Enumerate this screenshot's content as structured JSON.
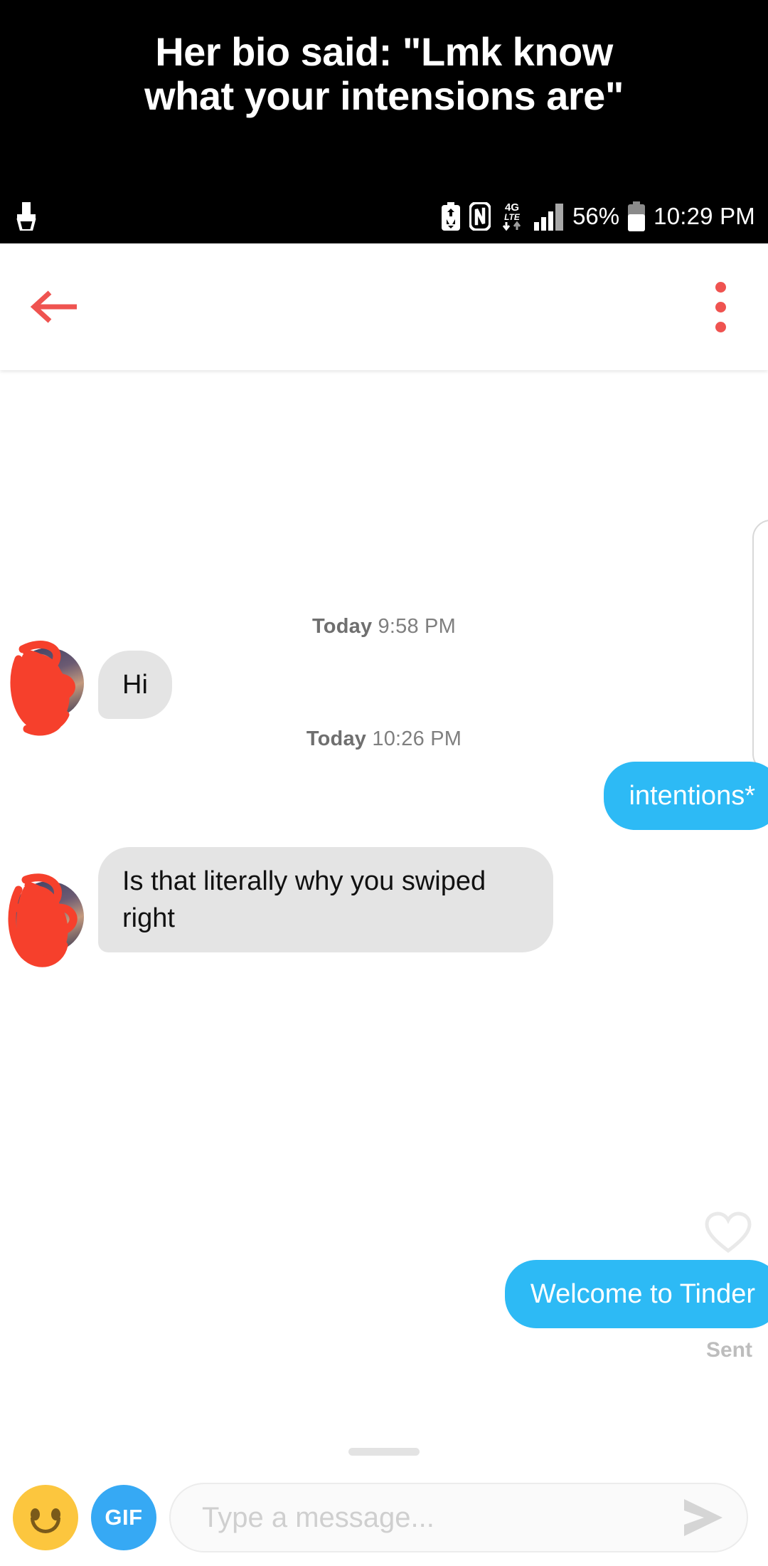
{
  "meme": {
    "caption_line1": "Her bio said: \"Lmk know",
    "caption_line2": "what your intensions are\"",
    "background_color": "#000000",
    "text_color": "#ffffff"
  },
  "status_bar": {
    "left_icons": [
      "screenshot-capture-icon"
    ],
    "right_icons": [
      "battery-saver-icon",
      "nfc-icon",
      "4g-lte-data-icon",
      "signal-bars-icon",
      "battery-icon"
    ],
    "battery_percent": "56%",
    "lte_label_top": "4G",
    "lte_label_bottom": "LTE",
    "time": "10:29 PM"
  },
  "app_bar": {
    "back_label": "back-arrow",
    "title_redacted": "[redacted]",
    "overflow_label": "more-options",
    "accent_color": "#ef5350"
  },
  "chat": {
    "day_stamps": [
      {
        "day": "Today",
        "time": "9:58 PM"
      },
      {
        "day": "Today",
        "time": "10:26 PM"
      }
    ],
    "messages": [
      {
        "id": "m1",
        "side": "them",
        "text": "Hi"
      },
      {
        "id": "m2",
        "side": "me",
        "text": "intentions*"
      },
      {
        "id": "m3",
        "side": "them",
        "text": "Is that literally why you swiped right"
      },
      {
        "id": "m4",
        "side": "me",
        "text": "Welcome to Tinder"
      }
    ],
    "delivery_status": "Sent",
    "like_icon": "heart-outline-icon",
    "bubble_them_color": "#e4e4e4",
    "bubble_me_color": "#2dbaf5"
  },
  "composer": {
    "emoji_button": "emoji-smiley",
    "gif_button_label": "GIF",
    "input_placeholder": "Type a message...",
    "input_value": "",
    "send_button": "send-arrow"
  }
}
